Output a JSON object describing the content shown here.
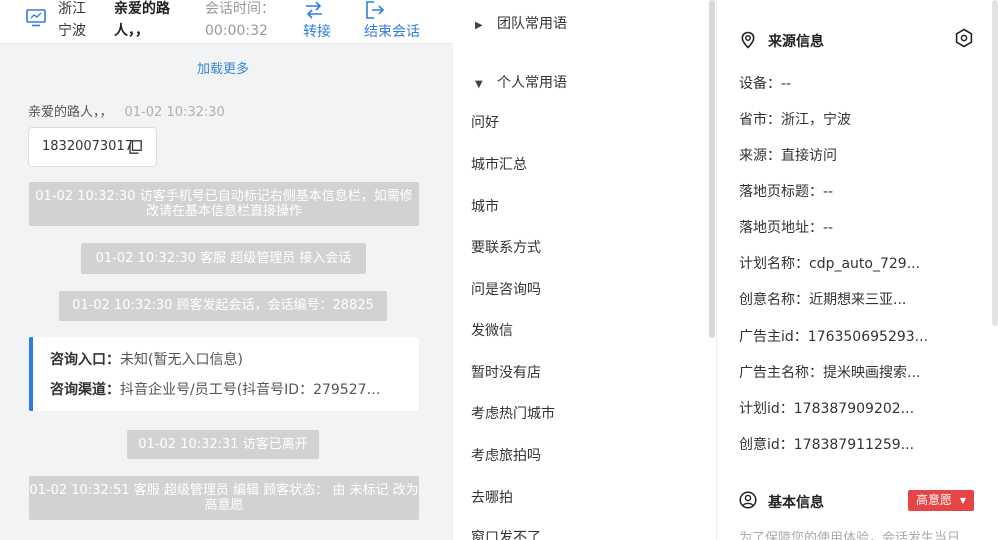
{
  "header": {
    "location": "浙江宁波",
    "visitor_name": "亲爱的路人，，",
    "time_label": "会话时间：",
    "time_value": "00:00:32",
    "transfer_label": "转接",
    "end_label": "结束会话"
  },
  "chat": {
    "load_more": "加载更多",
    "sender_name": "亲爱的路人，，",
    "sender_time": "01-02 10:32:30",
    "phone": "18320073017",
    "system_messages": [
      "01-02 10:32:30 访客手机号已自动标记右侧基本信息栏，如需修改请在基本信息栏直接操作",
      "01-02 10:32:30 客服 超级管理员 接入会话",
      "01-02 10:32:30 顾客发起会话，会话编号：28825",
      "01-02 10:32:31 访客已离开",
      "01-02 10:32:51 客服 超级管理员 编辑 顾客状态： 由 未标记 改为 高意愿"
    ],
    "entry_label": "咨询入口：",
    "entry_value": "未知(暂无入口信息)",
    "channel_label": "咨询渠道：",
    "channel_value": "抖音企业号/员工号(抖音号ID：279527…"
  },
  "phrases": {
    "team_group": "团队常用语",
    "personal_group": "个人常用语",
    "items": [
      "问好",
      "城市汇总",
      "城市",
      "要联系方式",
      "问是咨询吗",
      "发微信",
      "暂时没有店",
      "考虑热门城市",
      "考虑旅拍吗",
      "去哪拍",
      "窗口发不了"
    ]
  },
  "info": {
    "source_title": "来源信息",
    "rows": [
      "设备：--",
      "省市：浙江，宁波",
      "来源：直接访问",
      "落地页标题：--",
      "落地页地址：--",
      "计划名称：cdp_auto_729...",
      "创意名称：近期想来三亚...",
      "广告主id：176350695293...",
      "广告主名称：提米映画搜索...",
      "计划id：178387909202...",
      "创意id：178387911259..."
    ],
    "basic_title": "基本信息",
    "badge": "高意愿",
    "footnote": "为了保障您的使用体验，会话发生当日"
  },
  "colors": {
    "accent": "#2f7de1",
    "system_bubble": "#d2d2d2",
    "badge_red": "#e64545",
    "chat_bg": "#f2f3f5"
  }
}
